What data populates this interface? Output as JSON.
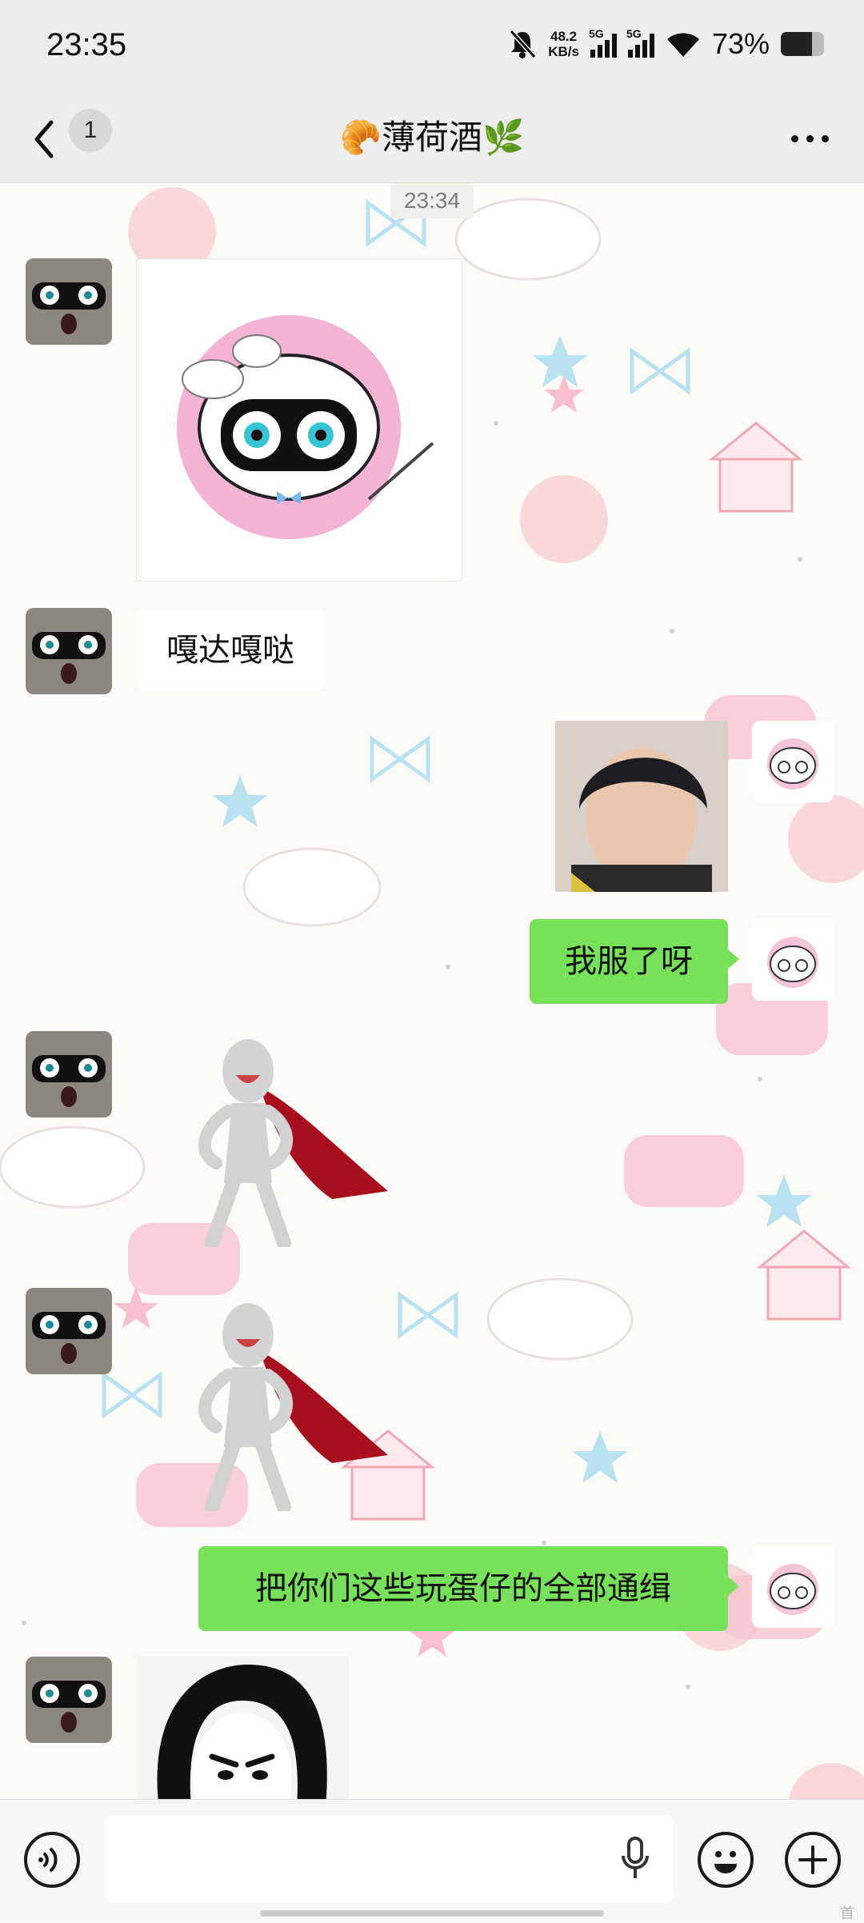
{
  "status_bar": {
    "time": "23:35",
    "network_speed_value": "48.2",
    "network_speed_unit": "KB/s",
    "sim1_label": "5G",
    "sim2_label": "5G",
    "battery_percent_text": "73%",
    "battery_level": 0.73,
    "icons": [
      "mute-bell-icon",
      "signal-icon",
      "wifi-icon",
      "battery-icon"
    ]
  },
  "header": {
    "unread_count": "1",
    "title": "🥐薄荷酒🌿"
  },
  "chat": {
    "timestamp": "23:34",
    "messages": [
      {
        "side": "left",
        "type": "sticker",
        "content": "masked-sheep-sticker"
      },
      {
        "side": "left",
        "type": "text",
        "content": "嘎达嘎哒"
      },
      {
        "side": "right",
        "type": "image",
        "content": "boy-photo"
      },
      {
        "side": "right",
        "type": "text",
        "content": "我服了呀"
      },
      {
        "side": "left",
        "type": "sticker",
        "content": "caped-figure-sticker"
      },
      {
        "side": "left",
        "type": "sticker",
        "content": "caped-figure-sticker"
      },
      {
        "side": "right",
        "type": "text",
        "content": "把你们这些玩蛋仔的全部通缉"
      },
      {
        "side": "left",
        "type": "sticker",
        "content": "ink-drawing-sticker"
      }
    ]
  },
  "input_bar": {
    "icons": [
      "voice-icon",
      "microphone-icon",
      "emoji-icon",
      "plus-icon"
    ],
    "watermark": "首"
  },
  "colors": {
    "outgoing_bubble": "#78e15b",
    "incoming_bubble": "#ffffff",
    "bar_background": "#ededed"
  }
}
